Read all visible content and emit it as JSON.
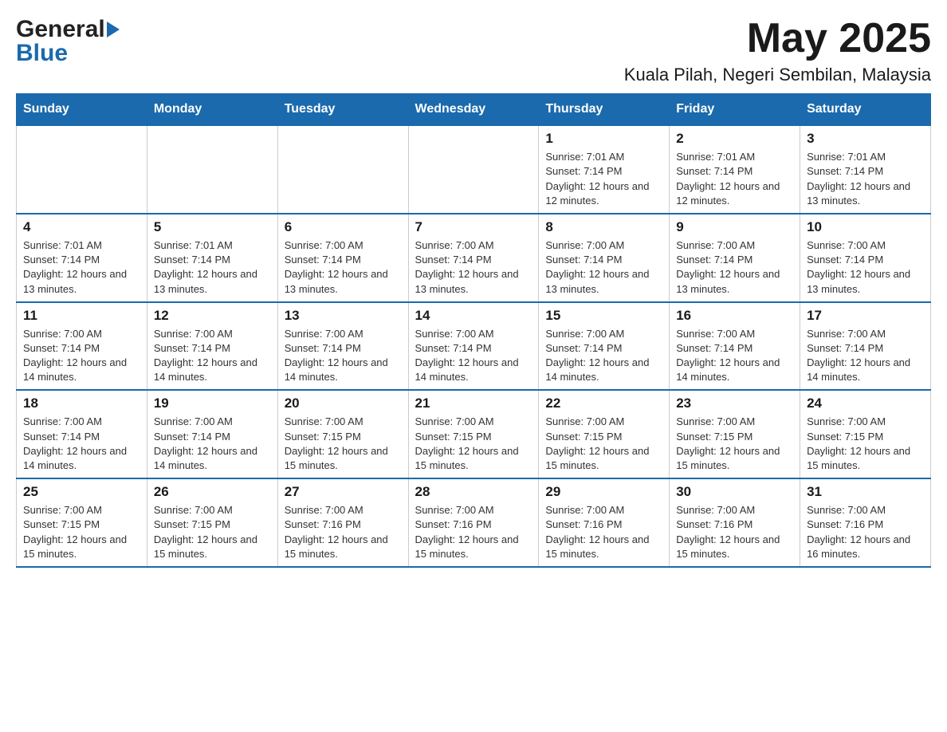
{
  "header": {
    "logo_general": "General",
    "logo_blue": "Blue",
    "month_title": "May 2025",
    "location": "Kuala Pilah, Negeri Sembilan, Malaysia"
  },
  "weekdays": [
    "Sunday",
    "Monday",
    "Tuesday",
    "Wednesday",
    "Thursday",
    "Friday",
    "Saturday"
  ],
  "weeks": [
    [
      {
        "day": "",
        "sunrise": "",
        "sunset": "",
        "daylight": ""
      },
      {
        "day": "",
        "sunrise": "",
        "sunset": "",
        "daylight": ""
      },
      {
        "day": "",
        "sunrise": "",
        "sunset": "",
        "daylight": ""
      },
      {
        "day": "",
        "sunrise": "",
        "sunset": "",
        "daylight": ""
      },
      {
        "day": "1",
        "sunrise": "Sunrise: 7:01 AM",
        "sunset": "Sunset: 7:14 PM",
        "daylight": "Daylight: 12 hours and 12 minutes."
      },
      {
        "day": "2",
        "sunrise": "Sunrise: 7:01 AM",
        "sunset": "Sunset: 7:14 PM",
        "daylight": "Daylight: 12 hours and 12 minutes."
      },
      {
        "day": "3",
        "sunrise": "Sunrise: 7:01 AM",
        "sunset": "Sunset: 7:14 PM",
        "daylight": "Daylight: 12 hours and 13 minutes."
      }
    ],
    [
      {
        "day": "4",
        "sunrise": "Sunrise: 7:01 AM",
        "sunset": "Sunset: 7:14 PM",
        "daylight": "Daylight: 12 hours and 13 minutes."
      },
      {
        "day": "5",
        "sunrise": "Sunrise: 7:01 AM",
        "sunset": "Sunset: 7:14 PM",
        "daylight": "Daylight: 12 hours and 13 minutes."
      },
      {
        "day": "6",
        "sunrise": "Sunrise: 7:00 AM",
        "sunset": "Sunset: 7:14 PM",
        "daylight": "Daylight: 12 hours and 13 minutes."
      },
      {
        "day": "7",
        "sunrise": "Sunrise: 7:00 AM",
        "sunset": "Sunset: 7:14 PM",
        "daylight": "Daylight: 12 hours and 13 minutes."
      },
      {
        "day": "8",
        "sunrise": "Sunrise: 7:00 AM",
        "sunset": "Sunset: 7:14 PM",
        "daylight": "Daylight: 12 hours and 13 minutes."
      },
      {
        "day": "9",
        "sunrise": "Sunrise: 7:00 AM",
        "sunset": "Sunset: 7:14 PM",
        "daylight": "Daylight: 12 hours and 13 minutes."
      },
      {
        "day": "10",
        "sunrise": "Sunrise: 7:00 AM",
        "sunset": "Sunset: 7:14 PM",
        "daylight": "Daylight: 12 hours and 13 minutes."
      }
    ],
    [
      {
        "day": "11",
        "sunrise": "Sunrise: 7:00 AM",
        "sunset": "Sunset: 7:14 PM",
        "daylight": "Daylight: 12 hours and 14 minutes."
      },
      {
        "day": "12",
        "sunrise": "Sunrise: 7:00 AM",
        "sunset": "Sunset: 7:14 PM",
        "daylight": "Daylight: 12 hours and 14 minutes."
      },
      {
        "day": "13",
        "sunrise": "Sunrise: 7:00 AM",
        "sunset": "Sunset: 7:14 PM",
        "daylight": "Daylight: 12 hours and 14 minutes."
      },
      {
        "day": "14",
        "sunrise": "Sunrise: 7:00 AM",
        "sunset": "Sunset: 7:14 PM",
        "daylight": "Daylight: 12 hours and 14 minutes."
      },
      {
        "day": "15",
        "sunrise": "Sunrise: 7:00 AM",
        "sunset": "Sunset: 7:14 PM",
        "daylight": "Daylight: 12 hours and 14 minutes."
      },
      {
        "day": "16",
        "sunrise": "Sunrise: 7:00 AM",
        "sunset": "Sunset: 7:14 PM",
        "daylight": "Daylight: 12 hours and 14 minutes."
      },
      {
        "day": "17",
        "sunrise": "Sunrise: 7:00 AM",
        "sunset": "Sunset: 7:14 PM",
        "daylight": "Daylight: 12 hours and 14 minutes."
      }
    ],
    [
      {
        "day": "18",
        "sunrise": "Sunrise: 7:00 AM",
        "sunset": "Sunset: 7:14 PM",
        "daylight": "Daylight: 12 hours and 14 minutes."
      },
      {
        "day": "19",
        "sunrise": "Sunrise: 7:00 AM",
        "sunset": "Sunset: 7:14 PM",
        "daylight": "Daylight: 12 hours and 14 minutes."
      },
      {
        "day": "20",
        "sunrise": "Sunrise: 7:00 AM",
        "sunset": "Sunset: 7:15 PM",
        "daylight": "Daylight: 12 hours and 15 minutes."
      },
      {
        "day": "21",
        "sunrise": "Sunrise: 7:00 AM",
        "sunset": "Sunset: 7:15 PM",
        "daylight": "Daylight: 12 hours and 15 minutes."
      },
      {
        "day": "22",
        "sunrise": "Sunrise: 7:00 AM",
        "sunset": "Sunset: 7:15 PM",
        "daylight": "Daylight: 12 hours and 15 minutes."
      },
      {
        "day": "23",
        "sunrise": "Sunrise: 7:00 AM",
        "sunset": "Sunset: 7:15 PM",
        "daylight": "Daylight: 12 hours and 15 minutes."
      },
      {
        "day": "24",
        "sunrise": "Sunrise: 7:00 AM",
        "sunset": "Sunset: 7:15 PM",
        "daylight": "Daylight: 12 hours and 15 minutes."
      }
    ],
    [
      {
        "day": "25",
        "sunrise": "Sunrise: 7:00 AM",
        "sunset": "Sunset: 7:15 PM",
        "daylight": "Daylight: 12 hours and 15 minutes."
      },
      {
        "day": "26",
        "sunrise": "Sunrise: 7:00 AM",
        "sunset": "Sunset: 7:15 PM",
        "daylight": "Daylight: 12 hours and 15 minutes."
      },
      {
        "day": "27",
        "sunrise": "Sunrise: 7:00 AM",
        "sunset": "Sunset: 7:16 PM",
        "daylight": "Daylight: 12 hours and 15 minutes."
      },
      {
        "day": "28",
        "sunrise": "Sunrise: 7:00 AM",
        "sunset": "Sunset: 7:16 PM",
        "daylight": "Daylight: 12 hours and 15 minutes."
      },
      {
        "day": "29",
        "sunrise": "Sunrise: 7:00 AM",
        "sunset": "Sunset: 7:16 PM",
        "daylight": "Daylight: 12 hours and 15 minutes."
      },
      {
        "day": "30",
        "sunrise": "Sunrise: 7:00 AM",
        "sunset": "Sunset: 7:16 PM",
        "daylight": "Daylight: 12 hours and 15 minutes."
      },
      {
        "day": "31",
        "sunrise": "Sunrise: 7:00 AM",
        "sunset": "Sunset: 7:16 PM",
        "daylight": "Daylight: 12 hours and 16 minutes."
      }
    ]
  ]
}
